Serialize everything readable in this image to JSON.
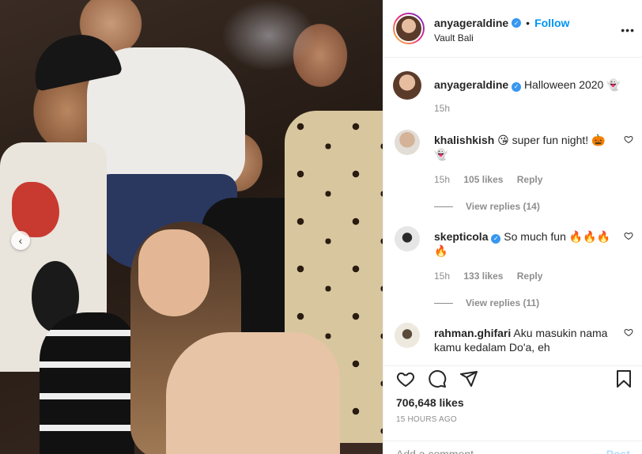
{
  "post": {
    "username": "anyageraldine",
    "follow_label": "Follow",
    "location": "Vault Bali",
    "caption": "Halloween 2020 👻",
    "caption_time": "15h"
  },
  "comments": [
    {
      "username": "khalishkish",
      "text": "😘 super fun night! 🎃👻",
      "time": "15h",
      "likes": "105 likes",
      "reply_label": "Reply",
      "view_replies": "View replies (14)",
      "avatar_color": "#cfc6bd"
    },
    {
      "username": "skepticola",
      "text": "So much fun 🔥🔥🔥🔥",
      "verified": true,
      "time": "15h",
      "likes": "133 likes",
      "reply_label": "Reply",
      "view_replies": "View replies (11)",
      "avatar_color": "#d9d9d9"
    },
    {
      "username": "rahman.ghifari",
      "text": "Aku masukin nama kamu kedalam Do'a, eh",
      "avatar_color": "#e8e2d6"
    }
  ],
  "stats": {
    "likes": "706,648 likes",
    "posted": "15 HOURS AGO"
  },
  "input": {
    "placeholder": "Add a comment…",
    "post_label": "Post"
  },
  "colors": {
    "link": "#0095f6",
    "verified": "#3897f0",
    "muted": "#8e8e8e"
  }
}
